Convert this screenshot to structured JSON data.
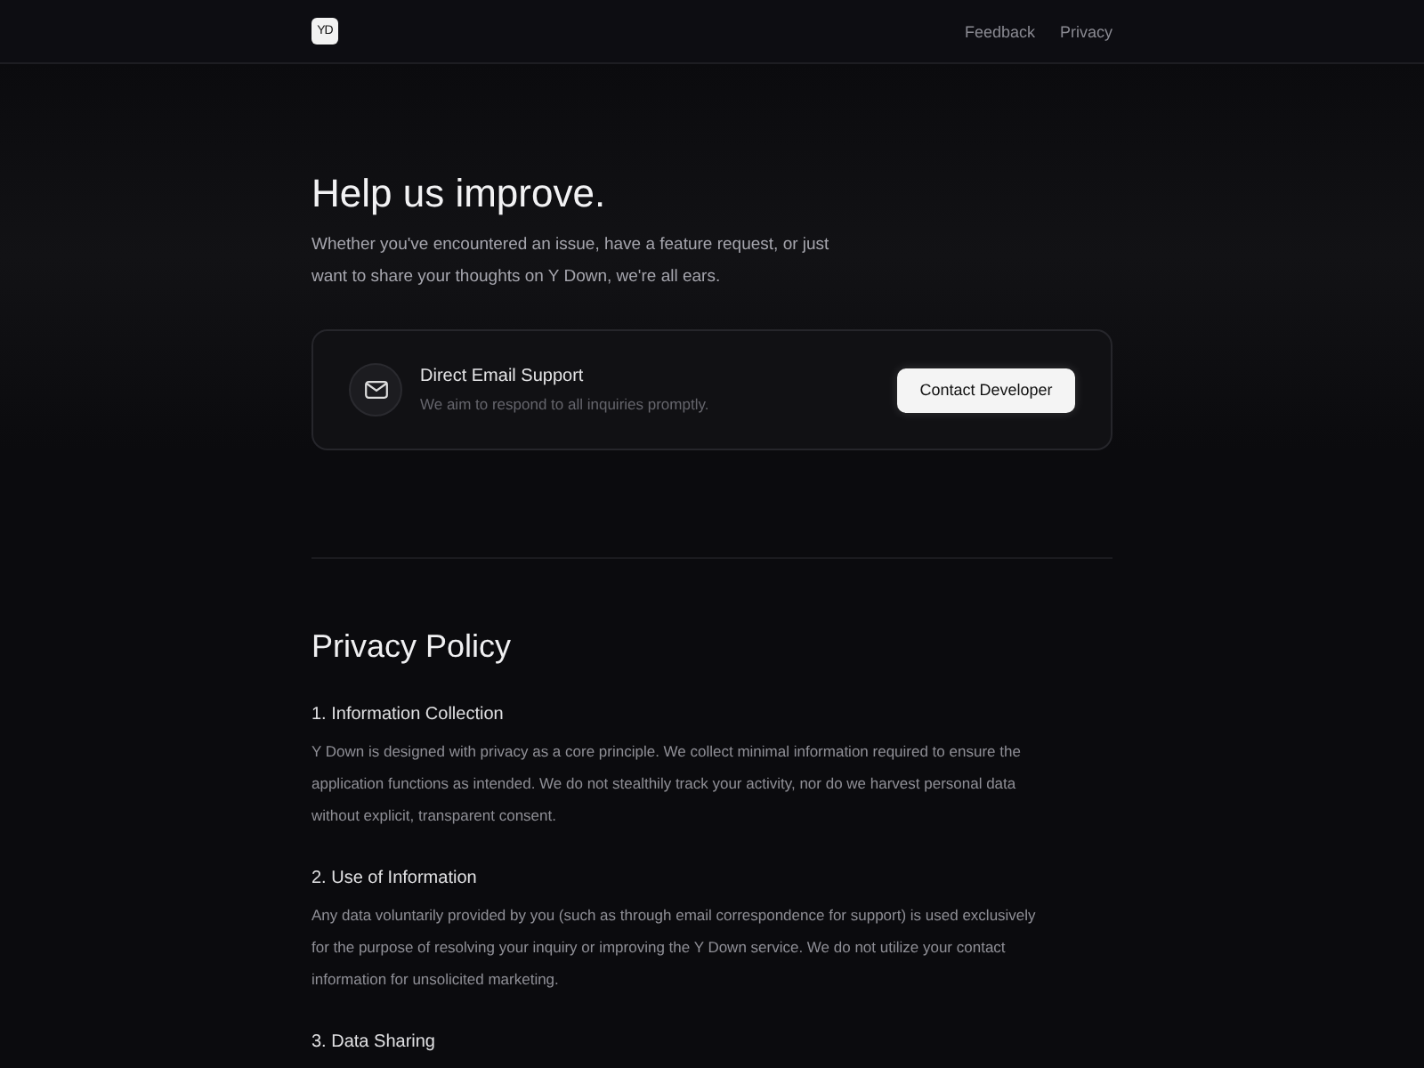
{
  "header": {
    "logo": "YD",
    "nav": [
      "Feedback",
      "Privacy"
    ]
  },
  "hero": {
    "title": "Help us improve.",
    "text": "Whether you've encountered an issue, have a feature request, or just want to share your thoughts on Y Down, we're all ears."
  },
  "support_card": {
    "title": "Direct Email Support",
    "subtitle": "We aim to respond to all inquiries promptly.",
    "button": "Contact Developer"
  },
  "privacy": {
    "title": "Privacy Policy",
    "sections": [
      {
        "heading": "1. Information Collection",
        "text": "Y Down is designed with privacy as a core principle. We collect minimal information required to ensure the application functions as intended. We do not stealthily track your activity, nor do we harvest personal data without explicit, transparent consent."
      },
      {
        "heading": "2. Use of Information",
        "text": "Any data voluntarily provided by you (such as through email correspondence for support) is used exclusively for the purpose of resolving your inquiry or improving the Y Down service. We do not utilize your contact information for unsolicited marketing."
      },
      {
        "heading": "3. Data Sharing"
      }
    ]
  }
}
